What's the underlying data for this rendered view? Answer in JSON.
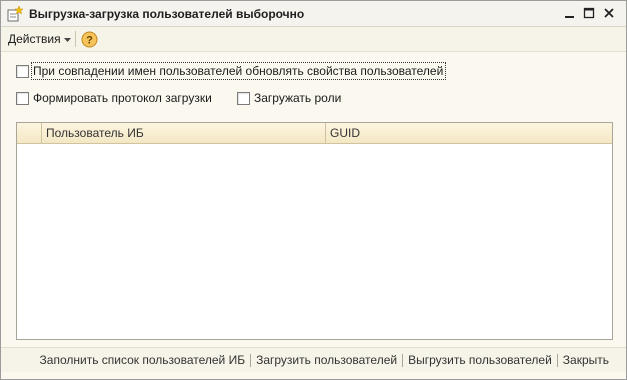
{
  "window": {
    "title": "Выгрузка-загрузка пользователей выборочно",
    "icons": [
      "form-icon",
      "minimize-icon",
      "maximize-icon",
      "close-icon"
    ]
  },
  "toolbar": {
    "actions_label": "Действия",
    "help_icon": "question-icon"
  },
  "options": {
    "update_props_label": "При совпадении имен пользователей обновлять свойства пользователей",
    "update_props_checked": false,
    "protocol_label": "Формировать протокол загрузки",
    "protocol_checked": false,
    "roles_label": "Загружать роли",
    "roles_checked": false
  },
  "table": {
    "columns": [
      "Пользователь ИБ",
      "GUID"
    ],
    "rows": []
  },
  "footer": {
    "fill_label": "Заполнить список пользователей ИБ",
    "load_label": "Загрузить пользователей",
    "unload_label": "Выгрузить пользователей",
    "close_label": "Закрыть"
  },
  "colors": {
    "window_bg": "#fbf9ef",
    "grid_header": "#f3e7c4",
    "help_icon": "#f0b030"
  }
}
